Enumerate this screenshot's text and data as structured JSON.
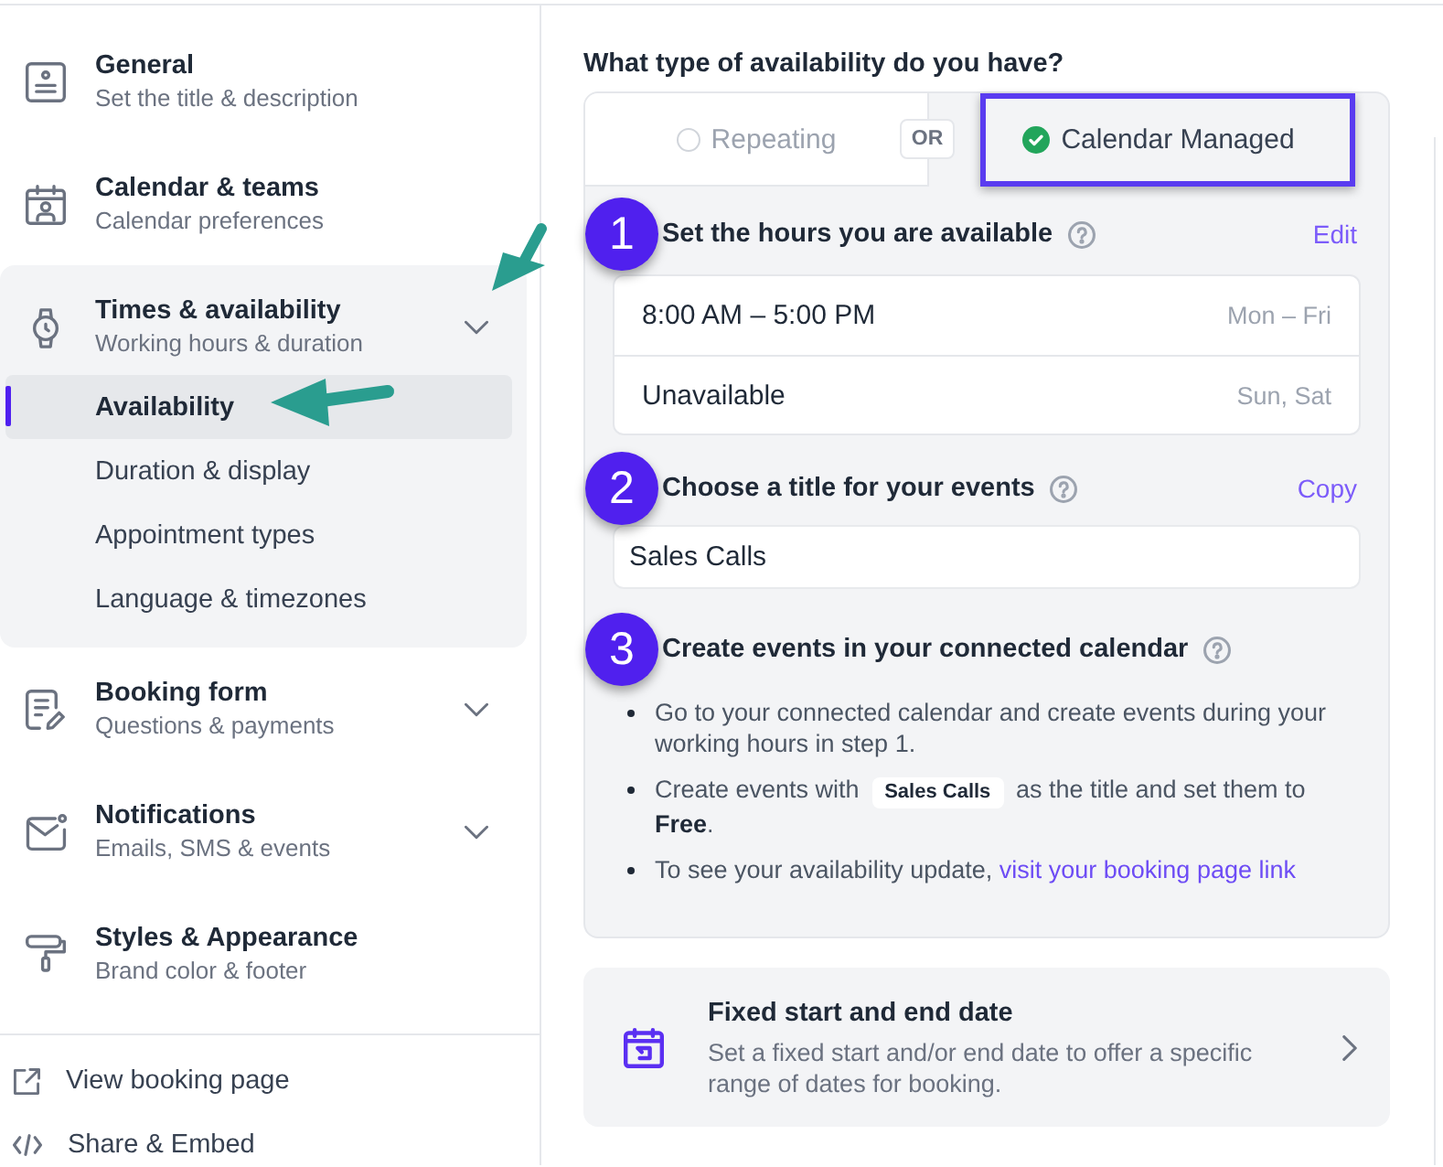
{
  "sidebar": {
    "items": [
      {
        "title": "General",
        "subtitle": "Set the title & description",
        "expandable": false,
        "expanded": false
      },
      {
        "title": "Calendar & teams",
        "subtitle": "Calendar preferences",
        "expandable": false,
        "expanded": false
      },
      {
        "title": "Times & availability",
        "subtitle": "Working hours & duration",
        "expandable": true,
        "expanded": true,
        "children": [
          {
            "label": "Availability",
            "selected": true
          },
          {
            "label": "Duration & display",
            "selected": false
          },
          {
            "label": "Appointment types",
            "selected": false
          },
          {
            "label": "Language & timezones",
            "selected": false
          }
        ]
      },
      {
        "title": "Booking form",
        "subtitle": "Questions & payments",
        "expandable": true,
        "expanded": false
      },
      {
        "title": "Notifications",
        "subtitle": "Emails, SMS & events",
        "expandable": true,
        "expanded": false
      },
      {
        "title": "Styles & Appearance",
        "subtitle": "Brand color & footer",
        "expandable": false,
        "expanded": false
      }
    ],
    "links": [
      {
        "label": "View booking page"
      },
      {
        "label": "Share & Embed"
      }
    ]
  },
  "main": {
    "question": "What type of availability do you have?",
    "options": [
      {
        "label": "Repeating",
        "selected": false,
        "highlighted": false
      },
      {
        "label": "Calendar Managed",
        "selected": true,
        "highlighted": true
      }
    ],
    "separator": "OR",
    "steps": [
      {
        "number": "1",
        "kind": "hours",
        "title": "Set the hours you are available",
        "action": "Edit",
        "hours": [
          {
            "time": "8:00 AM – 5:00 PM",
            "days": "Mon – Fri"
          },
          {
            "time": "Unavailable",
            "days": "Sun, Sat"
          }
        ]
      },
      {
        "number": "2",
        "kind": "title",
        "title": "Choose a title for your events",
        "action": "Copy",
        "value": "Sales Calls"
      },
      {
        "number": "3",
        "kind": "instructions",
        "title": "Create events in your connected calendar",
        "bullets": [
          {
            "text": "Go to your connected calendar and create events during your working hours in step 1."
          },
          {
            "text": "Create events with",
            "chip": "Sales Calls",
            "after": "as the title and set them to **Free**."
          },
          {
            "text": "To see your availability update,",
            "link": "visit your booking page link"
          }
        ]
      }
    ],
    "fixed_dates": {
      "title": "Fixed start and end date",
      "description": "Set a fixed start and/or end date to offer a specific range of dates for booking."
    }
  }
}
